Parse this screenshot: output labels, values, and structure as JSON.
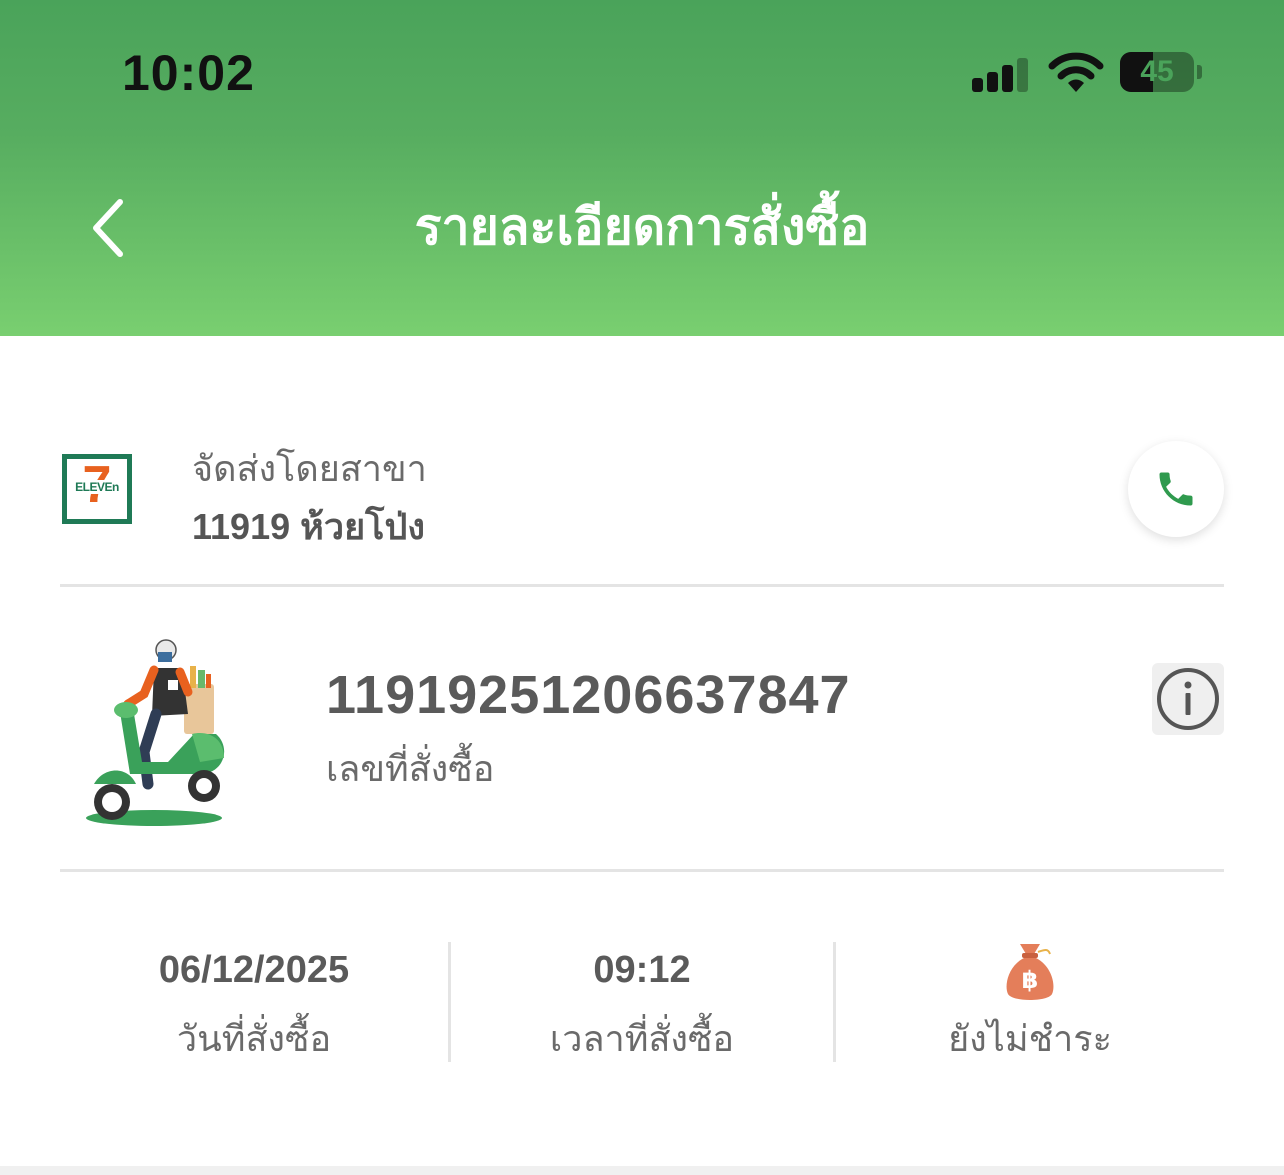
{
  "status_bar": {
    "time": "10:02",
    "battery_percent": "45"
  },
  "header": {
    "title": "รายละเอียดการสั่งซื้อ",
    "back_icon": "chevron-left-icon"
  },
  "branch": {
    "logo": "7-eleven-logo",
    "logo_mark": "7",
    "logo_word": "ELEVEn",
    "label": "จัดส่งโดยสาขา",
    "name": "11919 ห้วยโป่ง",
    "call_icon": "phone-icon"
  },
  "order": {
    "number": "11919251206637847",
    "label": "เลขที่สั่งซื้อ",
    "info_icon": "info-icon"
  },
  "summary": {
    "date": "06/12/2025",
    "date_label": "วันที่สั่งซื้อ",
    "time": "09:12",
    "time_label": "เวลาที่สั่งซื้อ",
    "payment_icon": "money-bag-icon",
    "payment_label": "ยังไม่ชำระ"
  },
  "colors": {
    "header_top": "#4aa35a",
    "header_bottom": "#79cf70",
    "accent_green": "#2f9a4e",
    "money_bag": "#e47e5a"
  }
}
